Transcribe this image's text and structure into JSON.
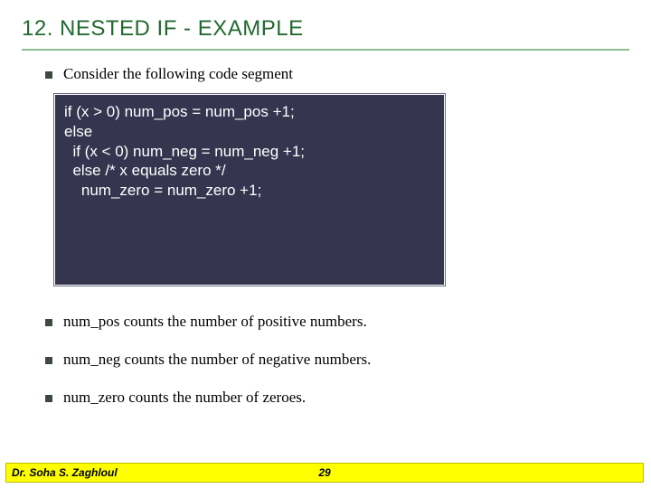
{
  "title": "12.  NESTED IF - EXAMPLE",
  "bullets": {
    "intro": "Consider the following code segment",
    "b1": "num_pos counts the number of positive numbers.",
    "b2": "num_neg counts the number of negative numbers.",
    "b3": "num_zero counts the number of zeroes."
  },
  "code": {
    "l1": "if (x > 0) num_pos = num_pos +1;",
    "l2": "else",
    "l3": "  if (x < 0) num_neg = num_neg +1;",
    "l4": "  else /* x equals zero */",
    "l5": "    num_zero = num_zero +1;"
  },
  "footer": {
    "author": "Dr. Soha S. Zaghloul",
    "page": "29"
  }
}
